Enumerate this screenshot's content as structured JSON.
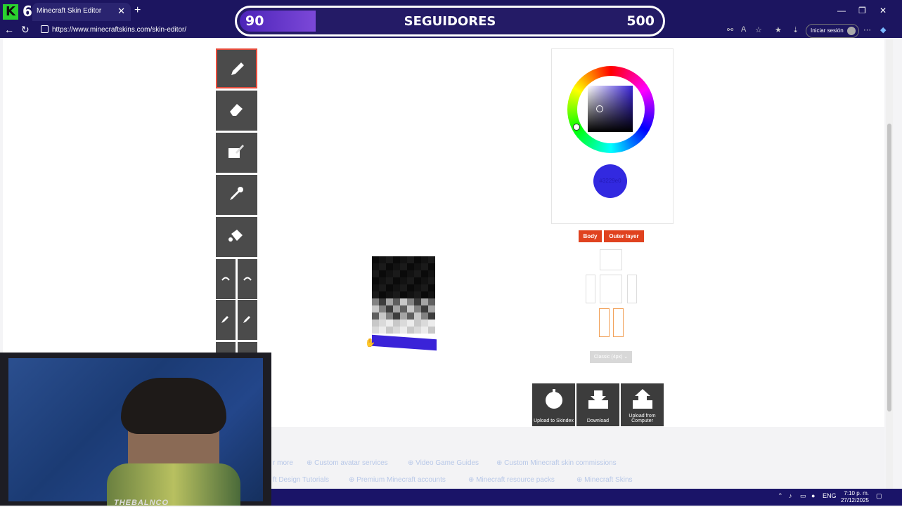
{
  "browser": {
    "kick_count": "6",
    "tab_title": "Minecraft Skin Editor",
    "url": "https://www.minecraftskins.com/skin-editor/",
    "signin_label": "Iniciar sesión"
  },
  "overlay": {
    "followers_current": "90",
    "followers_label": "SEGUIDORES",
    "followers_goal": "500",
    "progress_fraction": 0.18
  },
  "editor": {
    "tools": [
      "pencil",
      "eraser",
      "color-fill",
      "eyedropper",
      "bucket",
      "undo",
      "redo",
      "add-layer",
      "remove-layer"
    ],
    "active_tool": "pencil",
    "color_hex": "#3229e0",
    "color_label": "#3229e0",
    "layer_buttons": [
      "Body",
      "Outer layer"
    ],
    "model_select": "Classic (4px)",
    "actions": [
      "Upload to Skindex",
      "Download",
      "Upload from Computer"
    ]
  },
  "footer_links": {
    "row1": [
      "r more",
      "⊕ Custom avatar services",
      "⊕ Video Game Guides",
      "⊕ Custom Minecraft skin commissions"
    ],
    "row2": [
      "ft Design Tutorials",
      "⊕ Premium Minecraft accounts",
      "⊕ Minecraft resource packs",
      "⊕ Minecraft Skins"
    ]
  },
  "taskbar": {
    "lang": "ENG",
    "time": "7:10 p. m.",
    "date": "27/12/2025"
  },
  "webcam": {
    "watermark": "THEBALNCO"
  },
  "colors": {
    "brand_purple": "#1c1560",
    "accent_red": "#e0421f",
    "tool_gray": "#4b4b4b"
  }
}
